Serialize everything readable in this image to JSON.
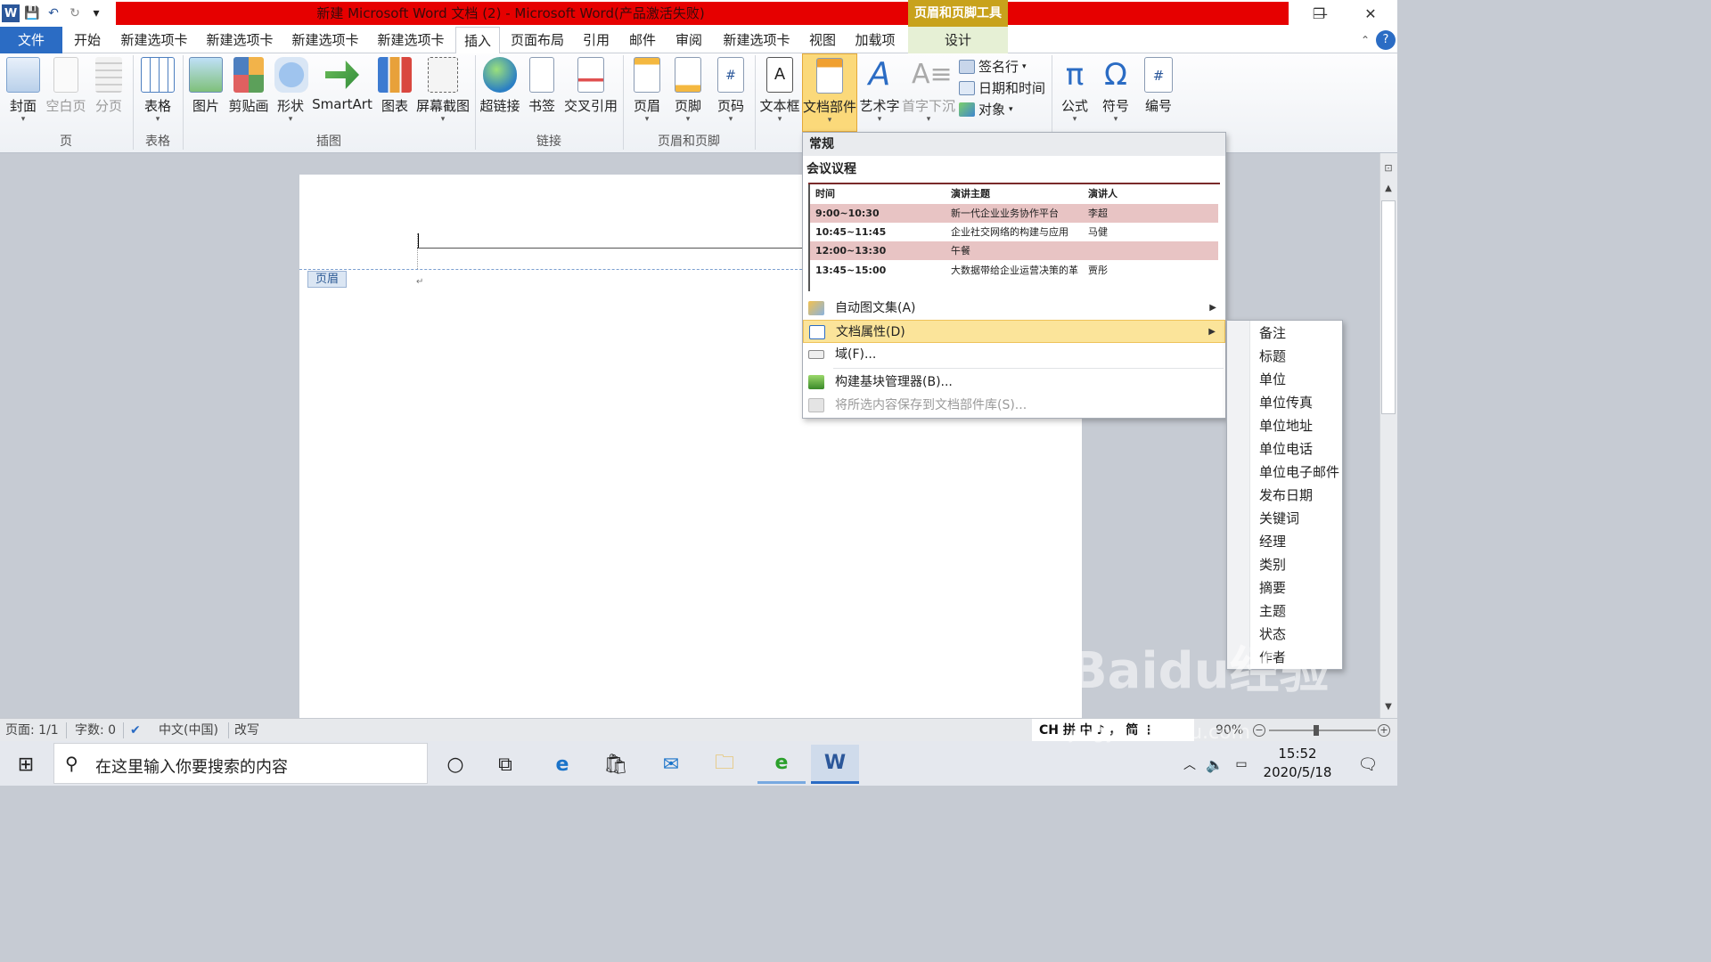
{
  "window": {
    "title": "新建 Microsoft Word 文档 (2) - Microsoft Word(产品激活失败)",
    "context_tab_group": "页眉和页脚工具",
    "minimize": "—",
    "restore": "❐",
    "close": "✕"
  },
  "qat": {
    "word": "W",
    "save": "💾",
    "undo": "↶",
    "redo": "↻",
    "more": "▾"
  },
  "tabs": {
    "file": "文件",
    "home": "开始",
    "new1": "新建选项卡",
    "new2": "新建选项卡",
    "new3": "新建选项卡",
    "new4": "新建选项卡",
    "insert": "插入",
    "layout": "页面布局",
    "references": "引用",
    "mailings": "邮件",
    "review": "审阅",
    "new5": "新建选项卡",
    "view": "视图",
    "addins": "加载项",
    "design": "设计"
  },
  "ribbon": {
    "cover": "封面",
    "blank_page": "空白页",
    "page_break": "分页",
    "table": "表格",
    "picture": "图片",
    "clipart": "剪贴画",
    "shapes": "形状",
    "smartart": "SmartArt",
    "chart": "图表",
    "screenshot": "屏幕截图",
    "hyperlink": "超链接",
    "bookmark": "书签",
    "crossref": "交叉引用",
    "header": "页眉",
    "footer": "页脚",
    "page_number": "页码",
    "textbox": "文本框",
    "quick_parts": "文档部件",
    "wordart": "艺术字",
    "dropcap": "首字下沉",
    "signature": "签名行",
    "datetime": "日期和时间",
    "object": "对象",
    "equation": "公式",
    "symbol": "符号",
    "number": "编号",
    "groups": {
      "pages": "页",
      "tables": "表格",
      "illustrations": "插图",
      "links": "链接",
      "header_footer": "页眉和页脚"
    }
  },
  "document": {
    "header_tag": "页眉"
  },
  "dropdown": {
    "section": "常规",
    "gallery_title": "会议议程",
    "gallery_head": [
      "时间",
      "演讲主题",
      "演讲人"
    ],
    "gallery_rows": [
      [
        "9:00~10:30",
        "新一代企业业务协作平台",
        "李超"
      ],
      [
        "10:45~11:45",
        "企业社交网络的构建与应用",
        "马健"
      ],
      [
        "12:00~13:30",
        "午餐",
        ""
      ],
      [
        "13:45~15:00",
        "大数据带给企业运营决策的革",
        "贾彤"
      ]
    ],
    "items": {
      "autotext": "自动图文集(A)",
      "docprops": "文档属性(D)",
      "field": "域(F)...",
      "organizer": "构建基块管理器(B)...",
      "save_selection": "将所选内容保存到文档部件库(S)..."
    }
  },
  "submenu": [
    "备注",
    "标题",
    "单位",
    "单位传真",
    "单位地址",
    "单位电话",
    "单位电子邮件",
    "发布日期",
    "关键词",
    "经理",
    "类别",
    "摘要",
    "主题",
    "状态",
    "作者"
  ],
  "status": {
    "page": "页面: 1/1",
    "words": "字数: 0",
    "language": "中文(中国)",
    "mode": "改写",
    "ime": "CH 拼 中 ♪ ， 简 ⋮",
    "zoom": "90%"
  },
  "taskbar": {
    "search_placeholder": "在这里输入你要搜索的内容",
    "time": "15:52",
    "date": "2020/5/18"
  },
  "watermark": {
    "line1": "Baidu经验",
    "line2": "jingyan.baidu.com"
  },
  "colors": {
    "title_red": "#e60000",
    "file_tab": "#2b6cc4",
    "context_gold": "#c8a21c",
    "highlight": "#fbe49a"
  }
}
